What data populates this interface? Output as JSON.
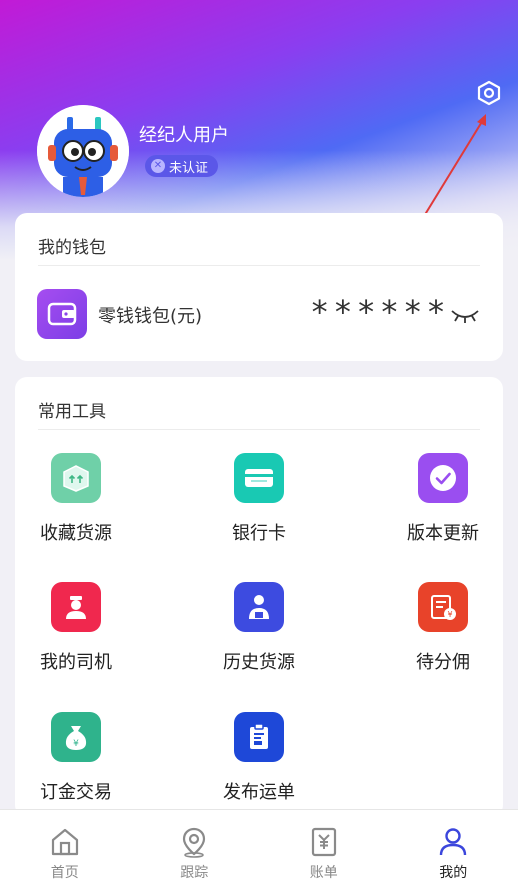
{
  "user": {
    "name": "经纪人用户",
    "auth_status": "未认证"
  },
  "wallet": {
    "title": "我的钱包",
    "item_label": "零钱钱包(元)",
    "amount_masked": "******"
  },
  "tools": {
    "title": "常用工具",
    "items": [
      {
        "label": "收藏货源",
        "icon": "box-icon",
        "color": "#6fd0a8"
      },
      {
        "label": "银行卡",
        "icon": "bank-card-icon",
        "color": "#19c9b3"
      },
      {
        "label": "版本更新",
        "icon": "check-circle-icon",
        "color": "#9a4ef0"
      },
      {
        "label": "我的司机",
        "icon": "driver-icon",
        "color": "#f0284e"
      },
      {
        "label": "历史货源",
        "icon": "person-package-icon",
        "color": "#3d4be0"
      },
      {
        "label": "待分佣",
        "icon": "bill-icon",
        "color": "#e8432a"
      },
      {
        "label": "订金交易",
        "icon": "money-bag-icon",
        "color": "#2fb38c"
      },
      {
        "label": "发布运单",
        "icon": "clipboard-truck-icon",
        "color": "#1e48d8"
      }
    ]
  },
  "tabbar": {
    "items": [
      {
        "label": "首页",
        "icon": "home-icon"
      },
      {
        "label": "跟踪",
        "icon": "location-pin-icon"
      },
      {
        "label": "账单",
        "icon": "yuan-bill-icon"
      },
      {
        "label": "我的",
        "icon": "user-icon"
      }
    ],
    "active": "我的"
  },
  "colors": {
    "accent": "#3b46dc",
    "badge": "#5b57e8"
  }
}
